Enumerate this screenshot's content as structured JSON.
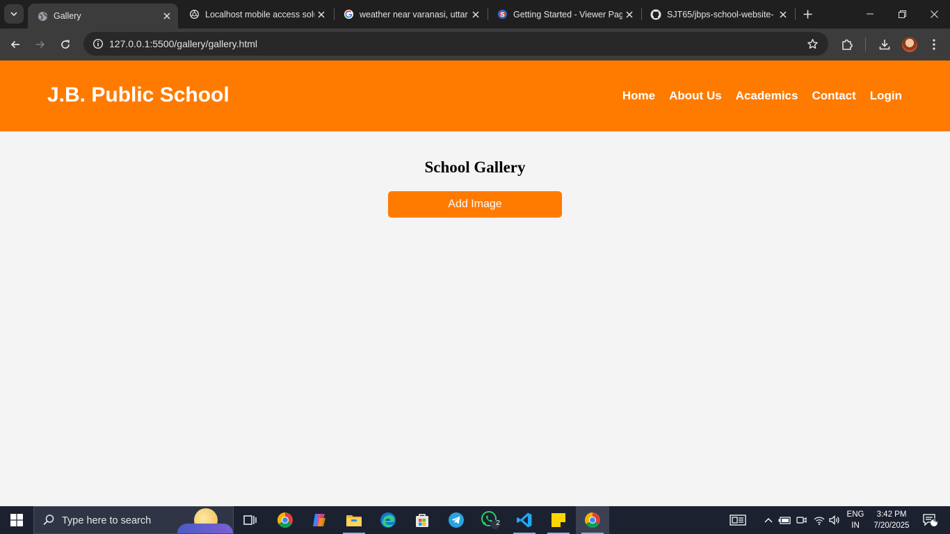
{
  "browser": {
    "tabs": [
      {
        "title": "Gallery",
        "icon": "globe-icon",
        "active": true
      },
      {
        "title": "Localhost mobile access solu",
        "icon": "openai-icon",
        "active": false
      },
      {
        "title": "weather near varanasi, uttar",
        "icon": "google-icon",
        "active": false
      },
      {
        "title": "Getting Started - Viewer Pag",
        "icon": "s-logo-icon",
        "active": false
      },
      {
        "title": "SJT65/jbps-school-website-",
        "icon": "github-icon",
        "active": false
      }
    ],
    "url": "127.0.0.1:5500/gallery/gallery.html"
  },
  "site": {
    "brand": "J.B. Public School",
    "nav": [
      "Home",
      "About Us",
      "Academics",
      "Contact",
      "Login"
    ],
    "heading": "School Gallery",
    "add_button": "Add Image"
  },
  "taskbar": {
    "search_placeholder": "Type here to search",
    "whatsapp_badge": "2",
    "lang_line1": "ENG",
    "lang_line2": "IN",
    "time": "3:42 PM",
    "date": "7/20/2025",
    "notifications": "4"
  },
  "colors": {
    "accent": "#ff7b00",
    "page_bg": "#f4f4f4",
    "chrome_dark": "#1f1f1f",
    "taskbar": "#1c2130"
  }
}
